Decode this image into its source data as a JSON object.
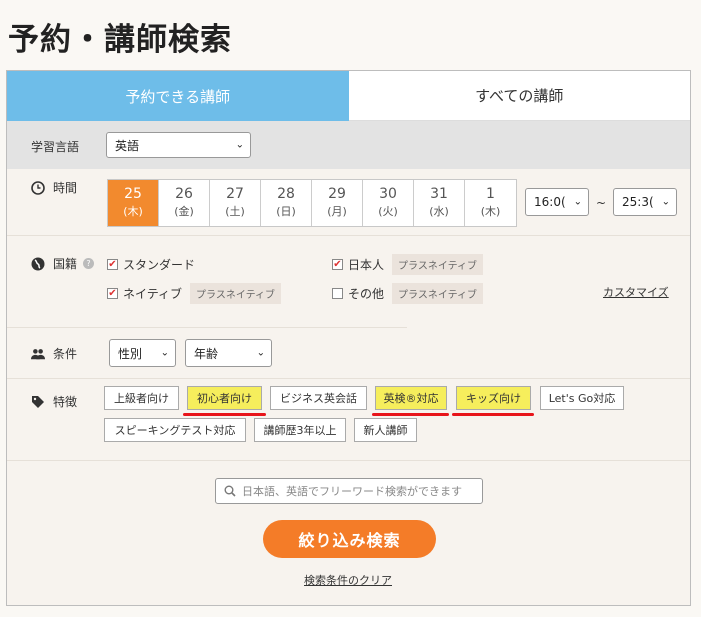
{
  "title": "予約・講師検索",
  "tabs": [
    {
      "label": "予約できる講師",
      "active": true
    },
    {
      "label": "すべての講師",
      "active": false
    }
  ],
  "language": {
    "label": "学習言語",
    "value": "英語"
  },
  "time": {
    "label": "時間",
    "dates": [
      {
        "day": "25",
        "weekday": "(木)",
        "selected": true
      },
      {
        "day": "26",
        "weekday": "(金)"
      },
      {
        "day": "27",
        "weekday": "(土)"
      },
      {
        "day": "28",
        "weekday": "(日)"
      },
      {
        "day": "29",
        "weekday": "(月)"
      },
      {
        "day": "30",
        "weekday": "(火)"
      },
      {
        "day": "31",
        "weekday": "(水)"
      },
      {
        "day": "1",
        "weekday": "(木)"
      }
    ],
    "from": "16:0(",
    "to": "25:3(",
    "tilde": "~"
  },
  "nationality": {
    "label": "国籍",
    "options": [
      {
        "label": "スタンダード",
        "checked": true,
        "tag": ""
      },
      {
        "label": "日本人",
        "checked": true,
        "tag": "プラスネイティブ"
      },
      {
        "label": "ネイティブ",
        "checked": true,
        "tag": "プラスネイティブ"
      },
      {
        "label": "その他",
        "checked": false,
        "tag": "プラスネイティブ"
      }
    ],
    "customize": "カスタマイズ"
  },
  "conditions": {
    "label": "条件",
    "gender": "性別",
    "age": "年齢"
  },
  "features": {
    "label": "特徴",
    "tags": [
      {
        "label": "上級者向け",
        "highlight": false
      },
      {
        "label": "初心者向け",
        "highlight": true
      },
      {
        "label": "ビジネス英会話",
        "highlight": false
      },
      {
        "label": "英検®対応",
        "highlight": true
      },
      {
        "label": "キッズ向け",
        "highlight": true
      },
      {
        "label": "Let's Go対応",
        "highlight": false
      },
      {
        "label": "スピーキングテスト対応",
        "highlight": false
      },
      {
        "label": "講師歴3年以上",
        "highlight": false
      },
      {
        "label": "新人講師",
        "highlight": false
      }
    ]
  },
  "search": {
    "placeholder": "日本語、英語でフリーワード検索ができます"
  },
  "submit": "絞り込み検索",
  "clear": "検索条件のクリア",
  "colors": {
    "tab_active": "#6ebde9",
    "accent": "#f47c28",
    "highlight": "#f6ee5c",
    "underline": "#e8141a"
  }
}
